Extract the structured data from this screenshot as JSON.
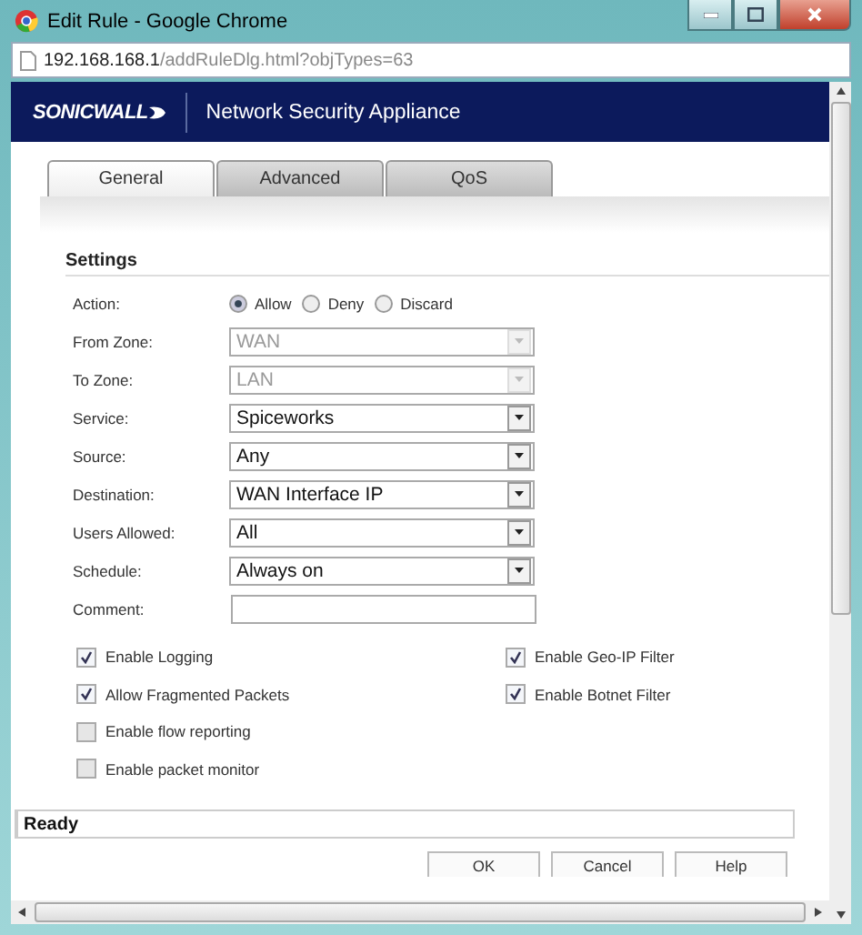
{
  "window": {
    "title": "Edit Rule - Google Chrome"
  },
  "address": {
    "host": "192.168.168.1",
    "path": "/addRuleDlg.html?objTypes=63"
  },
  "header": {
    "logo": "SONICWALL",
    "title": "Network Security Appliance"
  },
  "tabs": [
    {
      "label": "General",
      "selected": true
    },
    {
      "label": "Advanced",
      "selected": false
    },
    {
      "label": "QoS",
      "selected": false
    }
  ],
  "section": "Settings",
  "action": {
    "label": "Action:",
    "options": [
      {
        "label": "Allow",
        "selected": true
      },
      {
        "label": "Deny",
        "selected": false
      },
      {
        "label": "Discard",
        "selected": false
      }
    ]
  },
  "fields": [
    {
      "label": "From Zone:",
      "kind": "select",
      "value": "WAN",
      "disabled": true
    },
    {
      "label": "To Zone:",
      "kind": "select",
      "value": "LAN",
      "disabled": true
    },
    {
      "label": "Service:",
      "kind": "select",
      "value": "Spiceworks",
      "disabled": false
    },
    {
      "label": "Source:",
      "kind": "select",
      "value": "Any",
      "disabled": false
    },
    {
      "label": "Destination:",
      "kind": "select",
      "value": "WAN Interface IP",
      "disabled": false
    },
    {
      "label": "Users Allowed:",
      "kind": "select",
      "value": "All",
      "disabled": false
    },
    {
      "label": "Schedule:",
      "kind": "select",
      "value": "Always on",
      "disabled": false
    },
    {
      "label": "Comment:",
      "kind": "text"
    }
  ],
  "checkboxes": {
    "left": [
      {
        "label": "Enable Logging",
        "checked": true
      },
      {
        "label": "Allow Fragmented Packets",
        "checked": true
      },
      {
        "label": "Enable flow reporting",
        "checked": false
      },
      {
        "label": "Enable packet monitor",
        "checked": false
      }
    ],
    "right": [
      {
        "label": "Enable Geo-IP Filter",
        "checked": true
      },
      {
        "label": "Enable Botnet Filter",
        "checked": true
      }
    ]
  },
  "status": "Ready",
  "buttons": [
    "OK",
    "Cancel",
    "Help"
  ]
}
